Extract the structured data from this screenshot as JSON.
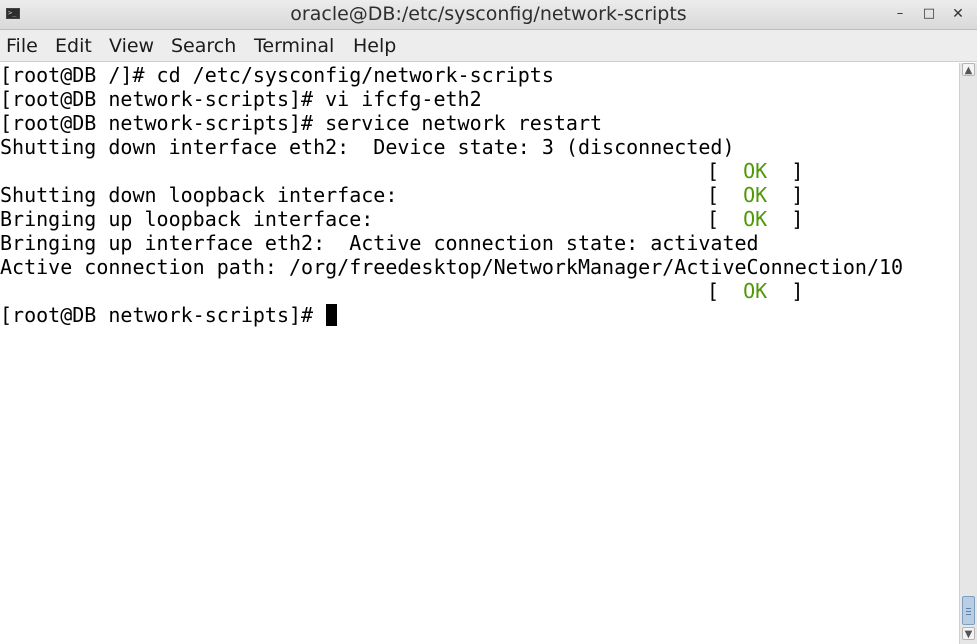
{
  "window": {
    "title": "oracle@DB:/etc/sysconfig/network-scripts",
    "icon": "terminal-icon",
    "controls": {
      "minimize": "–",
      "maximize": "□",
      "close": "✕"
    }
  },
  "menu": {
    "file": "File",
    "edit": "Edit",
    "view": "View",
    "search": "Search",
    "terminal": "Terminal",
    "help": "Help"
  },
  "terminal": {
    "lines": [
      "[root@DB /]# cd /etc/sysconfig/network-scripts",
      "[root@DB network-scripts]# vi ifcfg-eth2",
      "[root@DB network-scripts]# service network restart",
      "Shutting down interface eth2:  Device state: 3 (disconnected)",
      "",
      "Shutting down loopback interface:",
      "Bringing up loopback interface:",
      "Bringing up interface eth2:  Active connection state: activated",
      "Active connection path: /org/freedesktop/NetworkManager/ActiveConnection/10",
      "",
      "[root@DB network-scripts]# "
    ],
    "status": {
      "open": "[",
      "ok": "OK",
      "close": "]"
    },
    "ok_color": "#4e9a06"
  },
  "scrollbar": {
    "up_arrow": "▲",
    "down_arrow": "▼"
  }
}
